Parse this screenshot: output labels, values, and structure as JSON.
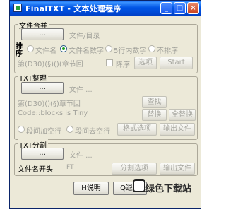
{
  "window": {
    "title": "FinalTXT - 文本处理程序",
    "min_glyph": "_",
    "max_glyph": "□",
    "close_glyph": "×"
  },
  "merge": {
    "group_label": "文件合并",
    "browse_label": "...",
    "path_label": "文件/目录",
    "sort_label": "排序",
    "radio_name": "文件名",
    "radio_name_num": "文件名数字",
    "radio_5_num": "5行内数字",
    "radio_no_sort": "不排序",
    "chapter_hint": "第(D30)(§)()(章节回",
    "desc_label": "降序",
    "option_button": "选项",
    "start_button": "Start"
  },
  "tidy": {
    "group_label": "TXT整理",
    "browse_label": "...",
    "file_label": "文件 ...",
    "chapter_hint": "第(D30)()(§)章节回",
    "find_button": "查找",
    "code_hint": "Code::blocks is Tiny",
    "replace_button": "替换",
    "replace_all_button": "全替换",
    "radio_para_add": "段间加空行",
    "radio_para_remove": "段间去空行",
    "format_button": "格式选项",
    "output_button": "输出文件"
  },
  "split": {
    "group_label": "TXT分割",
    "browse_label": "...",
    "file_label": "文件 ...",
    "prefix_label": "文件名开头",
    "prefix_value": "FT",
    "split_option_button": "分割选项",
    "output_button": "输出文件"
  },
  "footer": {
    "help_button": "H说明",
    "exit_button": "Q退出"
  },
  "watermark": {
    "text": "绿色下载站"
  }
}
